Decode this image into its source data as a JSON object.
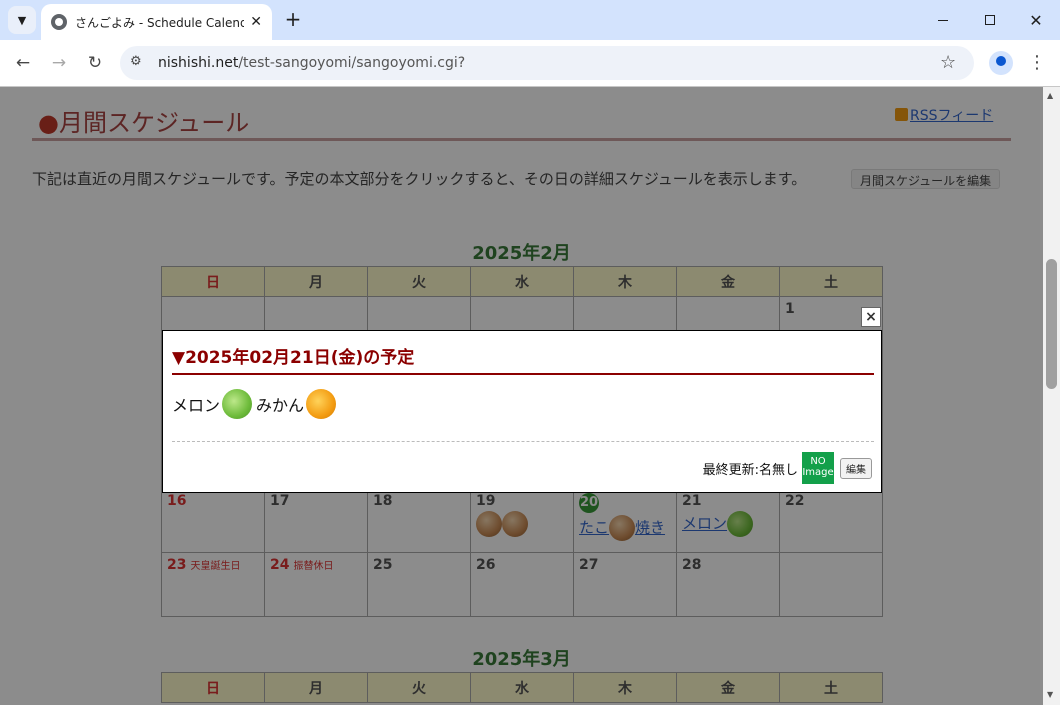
{
  "browser": {
    "tab_title": "さんごよみ - Schedule Calendar -",
    "tab_close": "✕",
    "new_tab": "+",
    "url_host": "nishishi.net",
    "url_path": "/test-sangoyomi/sangoyomi.cgi?",
    "window_close": "✕"
  },
  "page": {
    "title_dot": "●",
    "title": "月間スケジュール",
    "rss_label": "RSSフィード",
    "description": "下記は直近の月間スケジュールです。予定の本文部分をクリックすると、その日の詳細スケジュールを表示します。",
    "edit_month_label": "月間スケジュールを編集"
  },
  "calendar_feb": {
    "title": "2025年2月",
    "weekdays": [
      "日",
      "月",
      "火",
      "水",
      "木",
      "金",
      "土"
    ],
    "row1": [
      "",
      "",
      "",
      "",
      "",
      "",
      "1"
    ],
    "row4": [
      "16",
      "17",
      "18",
      "19",
      "20",
      "21",
      "22"
    ],
    "row5": [
      "23",
      "24",
      "25",
      "26",
      "27",
      "28",
      ""
    ],
    "holiday_23": "天皇誕生日",
    "holiday_24": "振替休日",
    "event_20_a": "たこ",
    "event_20_b": "焼き",
    "event_21": "メロン"
  },
  "calendar_mar": {
    "title": "2025年3月",
    "weekdays": [
      "日",
      "月",
      "火",
      "水",
      "木",
      "金",
      "土"
    ]
  },
  "modal": {
    "close_label": "×",
    "heading": "▼2025年02月21日(金)の予定",
    "item1": "メロン",
    "item2": "みかん",
    "updated_label": "最終更新:名無し",
    "noimage_line1": "NO",
    "noimage_line2": "Image",
    "edit_label": "編集"
  },
  "colors": {
    "heading_red": "#8b0000",
    "calendar_header_bg": "#fffbcc",
    "month_title_green": "#3a7a3a",
    "noimage_green": "#13a04a"
  }
}
